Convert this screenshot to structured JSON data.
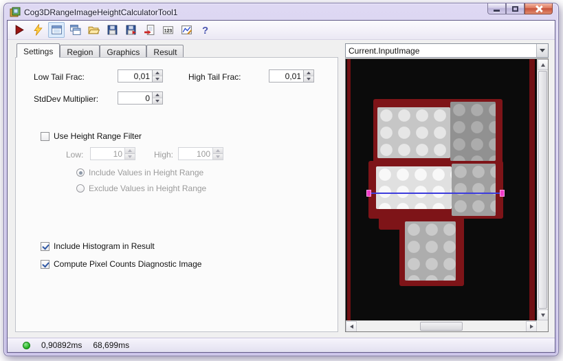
{
  "window": {
    "title": "Cog3DRangeImageHeightCalculatorTool1"
  },
  "toolbar": {
    "buttons": [
      "run-tool",
      "electric-run",
      "show-image-display",
      "copy-image-display",
      "open-tool",
      "save-tool",
      "save-results",
      "import-tool",
      "pixel-values",
      "line-profile",
      "help"
    ],
    "pixel_values_icon_text": "123",
    "help_icon_text": "?"
  },
  "tabs": [
    {
      "label": "Settings",
      "active": true
    },
    {
      "label": "Region",
      "active": false
    },
    {
      "label": "Graphics",
      "active": false
    },
    {
      "label": "Result",
      "active": false
    }
  ],
  "settings": {
    "low_tail_frac_label": "Low Tail Frac:",
    "low_tail_frac_value": "0,01",
    "high_tail_frac_label": "High Tail Frac:",
    "high_tail_frac_value": "0,01",
    "stddev_multiplier_label": "StdDev Multiplier:",
    "stddev_multiplier_value": "0",
    "use_height_range_filter_label": "Use Height Range Filter",
    "use_height_range_filter_checked": false,
    "low_label": "Low:",
    "low_value": "10",
    "high_label": "High:",
    "high_value": "100",
    "include_values_label": "Include Values in Height Range",
    "include_values_selected": true,
    "exclude_values_label": "Exclude Values in Height Range",
    "exclude_values_selected": false,
    "include_histogram_label": "Include Histogram in Result",
    "include_histogram_checked": true,
    "compute_pixel_counts_label": "Compute Pixel Counts Diagnostic Image",
    "compute_pixel_counts_checked": true
  },
  "image_panel": {
    "selected_image": "Current.InputImage"
  },
  "status_bar": {
    "execution_time": "0,90892ms",
    "total_time": "68,699ms"
  },
  "colors": {
    "maroon": "#7e1418",
    "status_green": "#1fae1f",
    "caliper_blue": "#3c3cdd",
    "handle_magenta": "#f23cc8"
  }
}
